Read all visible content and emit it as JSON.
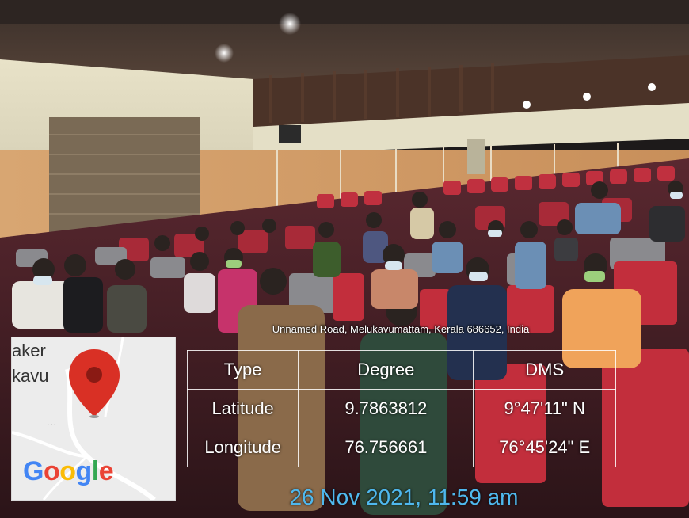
{
  "overlay": {
    "address": "Unnamed Road, Melukavumattam, Kerala 686652, India",
    "table": {
      "headers": [
        "Type",
        "Degree",
        "DMS"
      ],
      "rows": [
        [
          "Latitude",
          "9.7863812",
          "9°47'11\" N"
        ],
        [
          "Longitude",
          "76.756661",
          "76°45'24\" E"
        ]
      ]
    },
    "timestamp": "26 Nov 2021, 11:59 am"
  },
  "map": {
    "place_line_1": "aker",
    "place_line_2": "kavu",
    "dots": "...",
    "logo_letters": [
      "G",
      "o",
      "o",
      "g",
      "l",
      "e"
    ],
    "logo_colors": [
      "#4285F4",
      "#EA4335",
      "#FBBC05",
      "#4285F4",
      "#34A853",
      "#EA4335"
    ],
    "pin_icon": "location-pin-icon"
  },
  "colors": {
    "timestamp": "#4fb8ee",
    "pin": "#d93025"
  }
}
